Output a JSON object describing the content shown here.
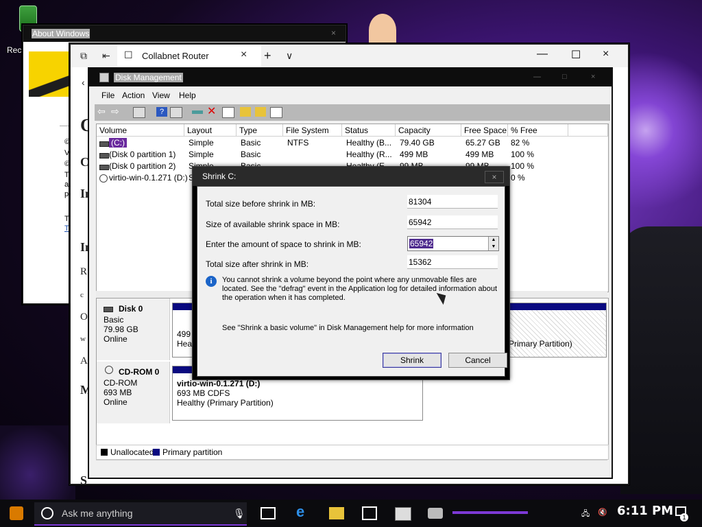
{
  "desktop": {
    "icon_label": "Rec"
  },
  "about_window": {
    "title": "About Windows",
    "close": "×",
    "text_lines": [
      "©",
      "Ve",
      "©",
      "Th",
      "ar",
      "pr",
      "Th",
      "Te"
    ]
  },
  "browser": {
    "tab_title": "Collabnet Router",
    "tab_close": "×",
    "new_tab": "+",
    "tab_list": "∨",
    "minimize": "—",
    "maximize": "☐",
    "close": "×",
    "side_letters": [
      "C",
      "C",
      "In",
      "In",
      "R",
      "c",
      "O",
      "w",
      "A",
      "M",
      "S"
    ]
  },
  "disk_mgmt": {
    "title": "Disk Management",
    "menu": [
      "File",
      "Action",
      "View",
      "Help"
    ],
    "columns": [
      "Volume",
      "Layout",
      "Type",
      "File System",
      "Status",
      "Capacity",
      "Free Space",
      "% Free"
    ],
    "rows": [
      {
        "volume": "(C:)",
        "layout": "Simple",
        "type": "Basic",
        "fs": "NTFS",
        "status": "Healthy (B...",
        "capacity": "79.40 GB",
        "free": "65.27 GB",
        "pct": "82 %"
      },
      {
        "volume": "(Disk 0 partition 1)",
        "layout": "Simple",
        "type": "Basic",
        "fs": "",
        "status": "Healthy (R...",
        "capacity": "499 MB",
        "free": "499 MB",
        "pct": "100 %"
      },
      {
        "volume": "(Disk 0 partition 2)",
        "layout": "Simple",
        "type": "Basic",
        "fs": "",
        "status": "Healthy (E...",
        "capacity": "99 MB",
        "free": "99 MB",
        "pct": "100 %"
      },
      {
        "volume": "virtio-win-0.1.271 (D:)",
        "layout": "S",
        "type": "",
        "fs": "",
        "status": "",
        "capacity": "",
        "free": "",
        "pct": "0 %"
      }
    ],
    "disk0": {
      "name": "Disk 0",
      "type": "Basic",
      "size": "79.98 GB",
      "state": "Online",
      "part1_size": "499 M",
      "part1_status": "Healt",
      "part3_status": "Primary Partition)"
    },
    "cdrom0": {
      "name": "CD-ROM 0",
      "type": "CD-ROM",
      "size": "693 MB",
      "state": "Online",
      "part_name": "virtio-win-0.1.271 (D:)",
      "part_info": "693 MB CDFS",
      "part_status": "Healthy (Primary Partition)"
    },
    "legend": [
      "Unallocated",
      "Primary partition"
    ],
    "colors": {
      "unallocated": "#000000",
      "primary": "#0a0a80"
    }
  },
  "shrink_dialog": {
    "title": "Shrink C:",
    "close": "×",
    "fields": [
      {
        "label": "Total size before shrink in MB:",
        "value": "81304"
      },
      {
        "label": "Size of available shrink space in MB:",
        "value": "65942"
      },
      {
        "label": "Enter the amount of space to shrink in MB:",
        "value": "65942"
      },
      {
        "label": "Total size after shrink in MB:",
        "value": "15362"
      }
    ],
    "info_text": "You cannot shrink a volume beyond the point where any unmovable files are located. See the \"defrag\" event in the Application log for detailed information about the operation when it has completed.",
    "help_text": "See \"Shrink a basic volume\" in Disk Management help for more information",
    "shrink_button": "Shrink",
    "cancel_button": "Cancel"
  },
  "taskbar": {
    "search_placeholder": "Ask me anything",
    "clock": "6:11 PM",
    "notification_count": "1",
    "accent": "#7d39d6"
  }
}
